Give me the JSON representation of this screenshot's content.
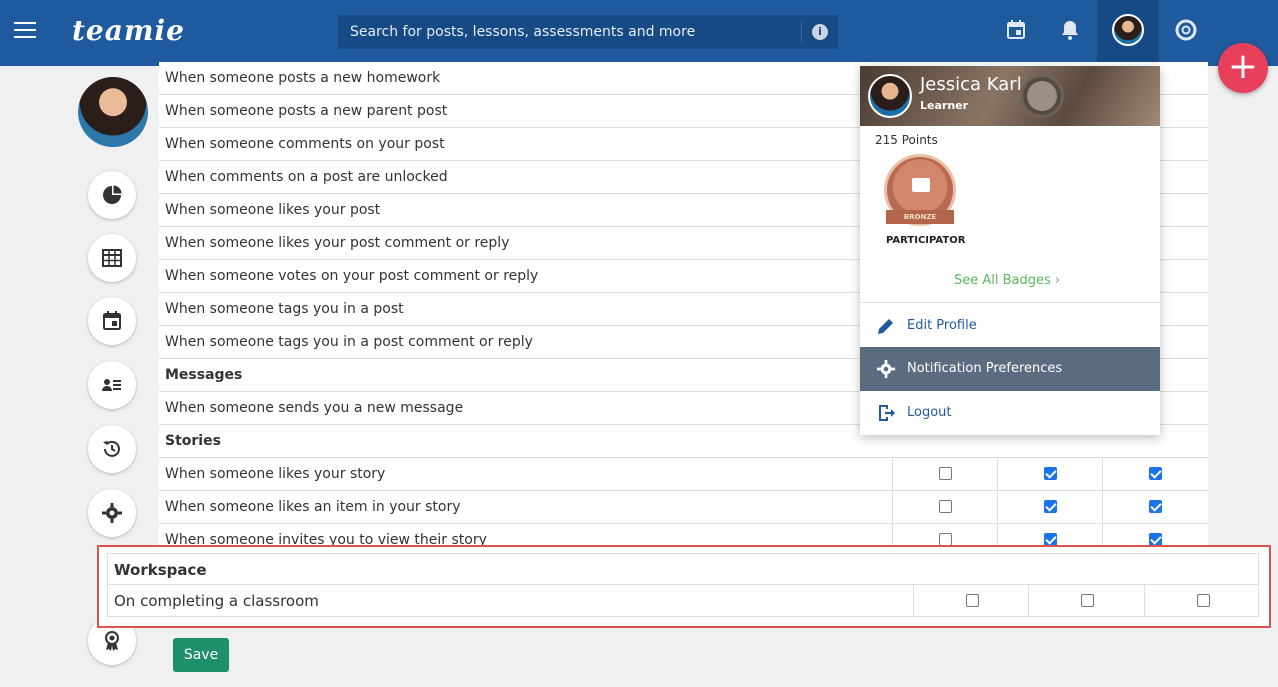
{
  "header": {
    "logo_text": "teamie",
    "search_placeholder": "Search for posts, lessons, assessments and more",
    "info_glyph": "i",
    "icons": [
      "menu-icon",
      "calendar-icon",
      "bell-icon",
      "lifebuoy-icon"
    ]
  },
  "fab_glyph": "+",
  "rail_icons": [
    "pie-chart-icon",
    "table-icon",
    "calendar-icon",
    "contacts-icon",
    "history-icon",
    "gear-icon",
    "award-icon"
  ],
  "rows": [
    {
      "label": "When someone posts a new homework",
      "type": "item"
    },
    {
      "label": "When someone posts a new parent post",
      "type": "item"
    },
    {
      "label": "When someone comments on your post",
      "type": "item"
    },
    {
      "label": "When comments on a post are unlocked",
      "type": "item"
    },
    {
      "label": "When someone likes your post",
      "type": "item"
    },
    {
      "label": "When someone likes your post comment or reply",
      "type": "item"
    },
    {
      "label": "When someone votes on your post comment or reply",
      "type": "item"
    },
    {
      "label": "When someone tags you in a post",
      "type": "item"
    },
    {
      "label": "When someone tags you in a post comment or reply",
      "type": "item"
    },
    {
      "label": "Messages",
      "type": "head"
    },
    {
      "label": "When someone sends you a new message",
      "type": "item"
    },
    {
      "label": "Stories",
      "type": "head"
    },
    {
      "label": "When someone likes your story",
      "type": "item",
      "checks": [
        false,
        true,
        true
      ]
    },
    {
      "label": "When someone likes an item in your story",
      "type": "item",
      "checks": [
        false,
        true,
        true
      ]
    },
    {
      "label": "When someone invites you to view their story",
      "type": "item",
      "checks": [
        false,
        true,
        true
      ]
    }
  ],
  "workspace": {
    "title": "Workspace",
    "row_label": "On completing a classroom",
    "checks": [
      false,
      false,
      false
    ]
  },
  "save_label": "Save",
  "dropdown": {
    "name": "Jessica Karl",
    "role": "Learner",
    "points": "215 Points",
    "badge_level": "BRONZE",
    "badge_name": "PARTICIPATOR",
    "see_all": "See All Badges",
    "items": [
      {
        "label": "Edit Profile",
        "icon": "pencil-icon"
      },
      {
        "label": "Notification Preferences",
        "icon": "gear-icon"
      },
      {
        "label": "Logout",
        "icon": "logout-icon"
      }
    ]
  }
}
